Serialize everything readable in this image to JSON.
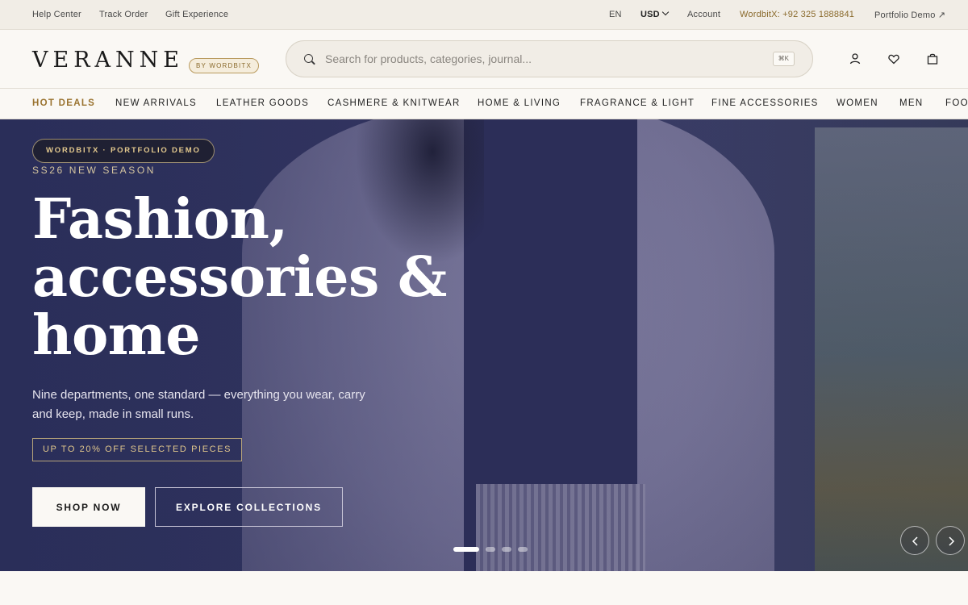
{
  "utility_bar": {
    "left_links": [
      "Help Center",
      "Track Order",
      "Gift Experience"
    ],
    "language": "EN",
    "currency": "USD",
    "account": "Account",
    "contact": "WordbitX: +92 325 1888841",
    "portfolio": "Portfolio Demo ↗"
  },
  "header": {
    "logo": "VERANNE",
    "logo_badge": "BY WORDBITX",
    "search": {
      "placeholder": "Search for products, categories, journal...",
      "shortcut": "⌘K"
    },
    "icons": [
      "user-icon",
      "heart-icon",
      "bag-icon"
    ]
  },
  "nav": {
    "items": [
      "HOT DEALS",
      "NEW ARRIVALS",
      "LEATHER GOODS",
      "CASHMERE & KNITWEAR",
      "HOME & LIVING",
      "FRAGRANCE & LIGHT",
      "FINE ACCESSORIES",
      "WOMEN",
      "MEN",
      "FOOTWEAR"
    ],
    "highlight_color": "#9a7330"
  },
  "hero": {
    "badge": "WORDBITX · PORTFOLIO DEMO",
    "season": "SS26 NEW SEASON",
    "headline_lines": [
      "Fashion,",
      "accessories &",
      "home"
    ],
    "description": "Nine departments, one standard — everything you wear, carry and keep, made in small runs.",
    "promo": "UP TO 20% OFF SELECTED PIECES",
    "primary_cta": "SHOP NOW",
    "secondary_cta": "EXPLORE COLLECTIONS",
    "slide_count": 4,
    "active_slide": 1
  },
  "colors": {
    "accent": "#8a6a2c",
    "hero_overlay": "#2c305a",
    "background": "#faf8f4"
  }
}
